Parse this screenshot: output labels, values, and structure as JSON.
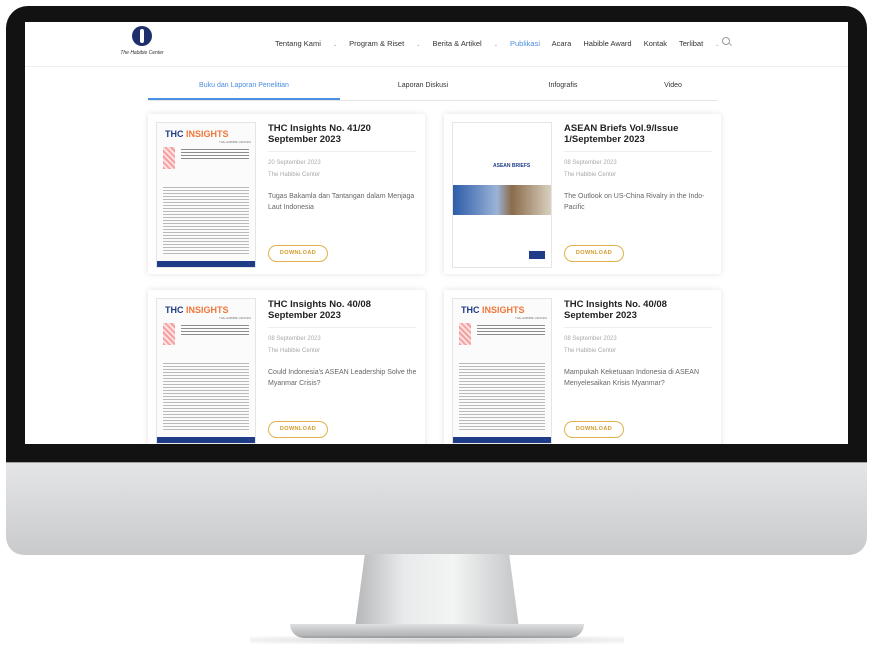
{
  "brand": {
    "logo_text": "The Habibie Center"
  },
  "nav": {
    "items": [
      {
        "label": "Tentang Kami",
        "has_caret": true
      },
      {
        "label": "Program & Riset",
        "has_caret": true
      },
      {
        "label": "Berita & Artikel",
        "has_caret": true
      },
      {
        "label": "Publikasi",
        "has_caret": false,
        "active": true
      },
      {
        "label": "Acara",
        "has_caret": false
      },
      {
        "label": "Habible Award",
        "has_caret": false
      },
      {
        "label": "Kontak",
        "has_caret": false
      },
      {
        "label": "Terlibat",
        "has_caret": true
      }
    ],
    "caret": "⌄",
    "search_icon": "search-icon"
  },
  "tabs": [
    {
      "label": "Buku dan Laporan Penelitian",
      "active": true
    },
    {
      "label": "Laporan Diskusi"
    },
    {
      "label": "Infografis"
    },
    {
      "label": "Video"
    }
  ],
  "cards": [
    {
      "title": "THC Insights No. 41/20 September 2023",
      "date": "20 September 2023",
      "author": "The Habibie Center",
      "description": "Tugas Bakamla dan Tantangan dalam Menjaga Laut Indonesia",
      "download_label": "DOWNLOAD",
      "thumb_brand_a": "THC ",
      "thumb_brand_b": "INSIGHTS",
      "thumb_sub": "THE HABIBIE CENTER"
    },
    {
      "title": "ASEAN Briefs Vol.9/Issue 1/September 2023",
      "date": "08 September 2023",
      "author": "The Habibie Center",
      "description": "The Outlook on US-China Rivalry in the Indo-Pacific",
      "download_label": "DOWNLOAD",
      "thumb_title": "ASEAN BRIEFS"
    },
    {
      "title": "THC Insights No. 40/08 September 2023",
      "date": "08 September 2023",
      "author": "The Habibie Center",
      "description": "Could Indonesia's ASEAN Leadership Solve the Myanmar Crisis?",
      "download_label": "DOWNLOAD",
      "thumb_brand_a": "THC ",
      "thumb_brand_b": "INSIGHTS",
      "thumb_sub": "THE HABIBIE CENTER"
    },
    {
      "title": "THC Insights No. 40/08 September 2023",
      "date": "08 September 2023",
      "author": "The Habibie Center",
      "description": "Mampukah Keketuaan Indonesia di ASEAN Menyelesaikan Krisis Myanmar?",
      "download_label": "DOWNLOAD",
      "thumb_brand_a": "THC ",
      "thumb_brand_b": "INSIGHTS",
      "thumb_sub": "THE HABIBIE CENTER"
    }
  ]
}
